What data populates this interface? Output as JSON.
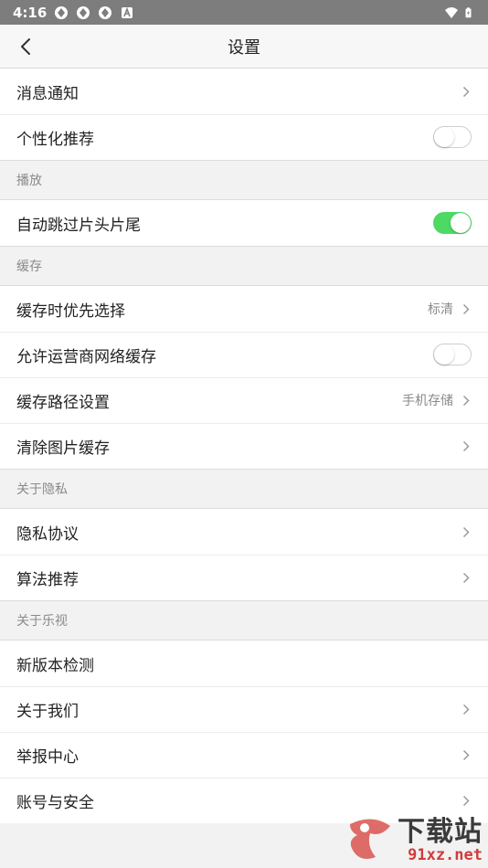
{
  "status_bar": {
    "time": "4:16",
    "icons": [
      "app-notification-icon",
      "app-notification-icon",
      "app-notification-icon",
      "text-notification-icon",
      "wifi-icon",
      "battery-charging-icon"
    ]
  },
  "header": {
    "back_icon": "chevron-left-icon",
    "title": "设置"
  },
  "groups": {
    "top": [
      {
        "label": "消息通知",
        "type": "arrow"
      },
      {
        "label": "个性化推荐",
        "type": "toggle",
        "on": false
      }
    ],
    "play": {
      "title": "播放",
      "items": [
        {
          "label": "自动跳过片头片尾",
          "type": "toggle",
          "on": true
        }
      ]
    },
    "cache": {
      "title": "缓存",
      "items": [
        {
          "label": "缓存时优先选择",
          "value": "标清",
          "type": "arrow"
        },
        {
          "label": "允许运营商网络缓存",
          "type": "toggle",
          "on": false
        },
        {
          "label": "缓存路径设置",
          "value": "手机存储",
          "type": "arrow"
        },
        {
          "label": "清除图片缓存",
          "type": "arrow"
        }
      ]
    },
    "privacy": {
      "title": "关于隐私",
      "items": [
        {
          "label": "隐私协议",
          "type": "arrow"
        },
        {
          "label": "算法推荐",
          "type": "arrow"
        }
      ]
    },
    "about": {
      "title": "关于乐视",
      "items": [
        {
          "label": "新版本检测",
          "type": "none"
        },
        {
          "label": "关于我们",
          "type": "arrow"
        },
        {
          "label": "举报中心",
          "type": "arrow"
        },
        {
          "label": "账号与安全",
          "type": "arrow"
        }
      ]
    }
  },
  "watermark": {
    "cn": "下载站",
    "url": "91xz.net"
  },
  "colors": {
    "toggle_on": "#4cd964",
    "status_bar": "#7d7d7d"
  }
}
